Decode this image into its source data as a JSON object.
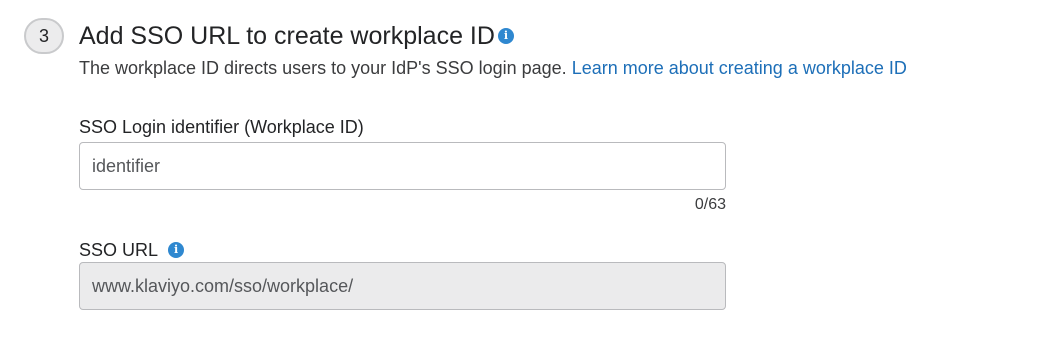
{
  "step": {
    "number": "3",
    "title": "Add SSO URL to create workplace ID",
    "description": "The workplace ID directs users to your IdP's SSO login page.",
    "learn_more_link": "Learn more about creating a workplace ID"
  },
  "workplace_id_field": {
    "label": "SSO Login identifier (Workplace ID)",
    "placeholder": "identifier",
    "value": "",
    "counter": "0/63"
  },
  "sso_url_field": {
    "label": "SSO URL",
    "value": "www.klaviyo.com/sso/workplace/"
  },
  "icons": {
    "title_info": "info-icon",
    "sso_url_info": "info-icon"
  },
  "colors": {
    "link": "#1d6fb8",
    "info_icon": "#2f88d0",
    "disabled_field_bg": "#ebebec"
  }
}
